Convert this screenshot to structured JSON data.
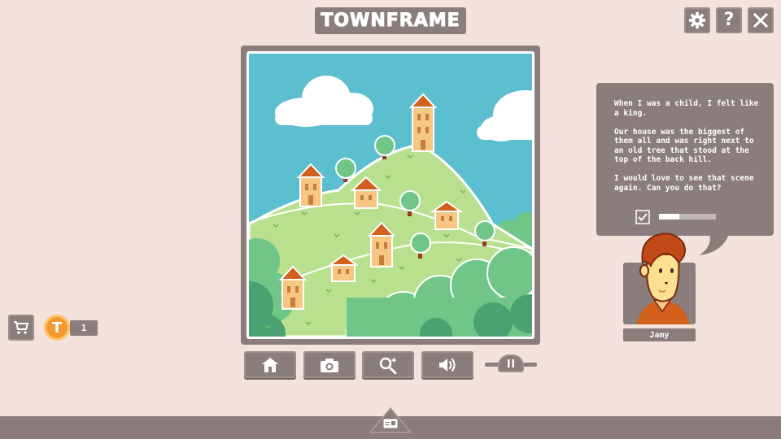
{
  "header": {
    "title": "TOWNFRAME"
  },
  "top_buttons": [
    {
      "name": "settings",
      "icon": "gear-icon"
    },
    {
      "name": "help",
      "icon": "question-icon",
      "label": "?"
    },
    {
      "name": "close",
      "icon": "close-icon"
    }
  ],
  "toolbar": [
    {
      "name": "home",
      "icon": "house-icon"
    },
    {
      "name": "camera",
      "icon": "camera-icon"
    },
    {
      "name": "zoom",
      "icon": "magnifier-sparkle-icon"
    },
    {
      "name": "sound",
      "icon": "speaker-icon"
    }
  ],
  "speed_slider": {
    "icon": "pause-icon"
  },
  "shop": {
    "icon": "cart-icon"
  },
  "currency": {
    "icon": "coin-icon",
    "coin_letter": "T",
    "amount": "1"
  },
  "dialogue": {
    "text": "When I was a child, I felt like\na king.\n\nOur house was the biggest of\nthem all and was right next to\nan old tree that stood at the\ntop of the back hill.\n\nI would love to see that scene\nagain. Can you do that?",
    "progress": 0.35,
    "check_icon": "checkbox-checked-icon"
  },
  "character": {
    "name": "Jamy"
  },
  "bottom_tab": {
    "icon": "postcard-icon"
  },
  "colors": {
    "background": "#f3e3dc",
    "panel": "#8a7d7b",
    "sky": "#5bbfcf",
    "grass": "#b9e08f",
    "bush": "#6fc687",
    "roof": "#d2611e",
    "wall": "#f6c683",
    "coin": "#f39a31"
  }
}
